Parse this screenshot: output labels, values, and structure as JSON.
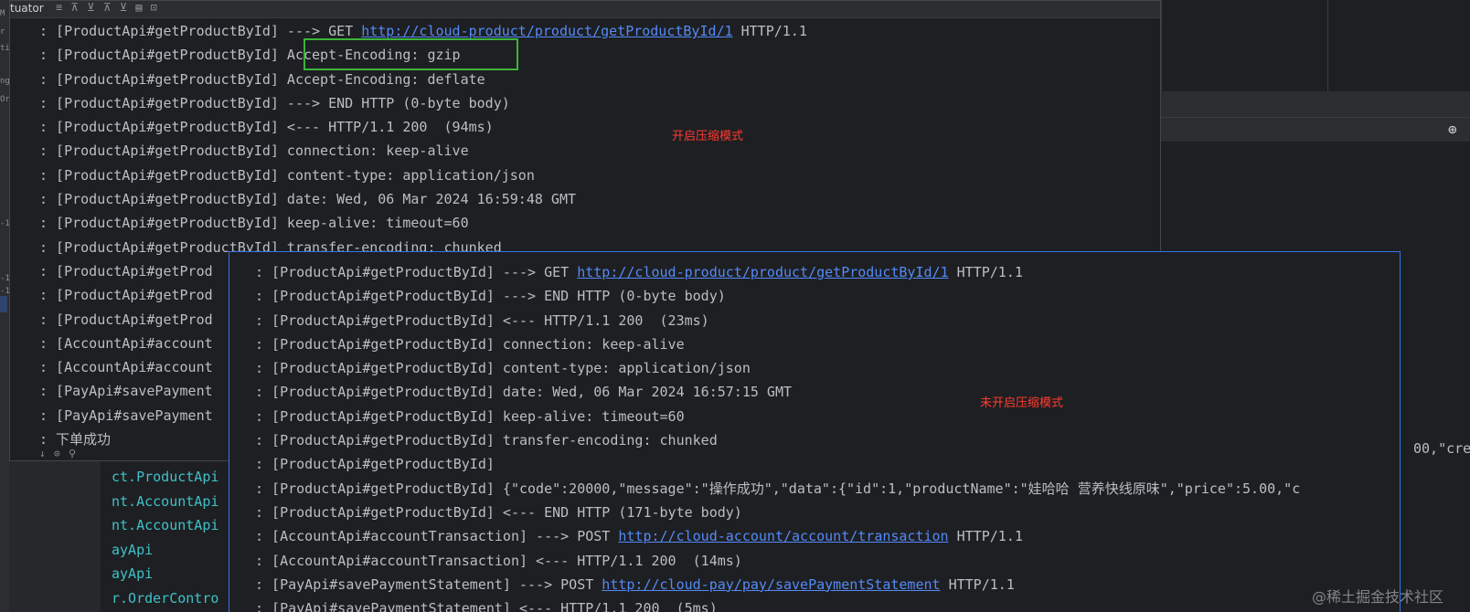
{
  "left_strip_marks": [
    "M",
    "r",
    "ti",
    "ng",
    "Or",
    "-1",
    "-1",
    "-1"
  ],
  "window_a": {
    "title": "tuator",
    "toolbar_icons": [
      "≡",
      "⊼",
      "⊻",
      "⊼",
      "⊻",
      "▤",
      "⊡"
    ],
    "lines": [
      {
        "text": ": [ProductApi#getProductById] ---> GET ",
        "url": "http://cloud-product/product/getProductById/1",
        "suffix": " HTTP/1.1"
      },
      {
        "text": ": [ProductApi#getProductById] Accept-Encoding: gzip"
      },
      {
        "text": ": [ProductApi#getProductById] Accept-Encoding: deflate"
      },
      {
        "text": ": [ProductApi#getProductById] ---> END HTTP (0-byte body)"
      },
      {
        "text": ": [ProductApi#getProductById] <--- HTTP/1.1 200  (94ms)"
      },
      {
        "text": ": [ProductApi#getProductById] connection: keep-alive"
      },
      {
        "text": ": [ProductApi#getProductById] content-type: application/json"
      },
      {
        "text": ": [ProductApi#getProductById] date: Wed, 06 Mar 2024 16:59:48 GMT"
      },
      {
        "text": ": [ProductApi#getProductById] keep-alive: timeout=60"
      },
      {
        "text": ": [ProductApi#getProductById] transfer-encoding: chunked"
      },
      {
        "text": ": [ProductApi#getProd"
      },
      {
        "text": ": [ProductApi#getProd"
      },
      {
        "text": ": [ProductApi#getProd"
      },
      {
        "text": ": [AccountApi#account"
      },
      {
        "text": ": [AccountApi#account"
      },
      {
        "text": ": [PayApi#savePayment"
      },
      {
        "text": ": [PayApi#savePayment"
      },
      {
        "text": ": 下单成功"
      }
    ],
    "footer": [
      "↓",
      "⊙",
      "⚲"
    ]
  },
  "label_compression_on": "开启压缩模式",
  "background_lines": [
    "ct.ProductApi",
    "nt.AccountApi",
    "nt.AccountApi",
    "ayApi",
    "ayApi",
    "r.OrderContro"
  ],
  "background_right_text": "00,\"cre",
  "window_b": {
    "lines": [
      {
        "text": ": [ProductApi#getProductById] ---> GET ",
        "url": "http://cloud-product/product/getProductById/1",
        "suffix": " HTTP/1.1"
      },
      {
        "text": ": [ProductApi#getProductById] ---> END HTTP (0-byte body)"
      },
      {
        "text": ": [ProductApi#getProductById] <--- HTTP/1.1 200  (23ms)"
      },
      {
        "text": ": [ProductApi#getProductById] connection: keep-alive"
      },
      {
        "text": ": [ProductApi#getProductById] content-type: application/json"
      },
      {
        "text": ": [ProductApi#getProductById] date: Wed, 06 Mar 2024 16:57:15 GMT"
      },
      {
        "text": ": [ProductApi#getProductById] keep-alive: timeout=60"
      },
      {
        "text": ": [ProductApi#getProductById] transfer-encoding: chunked"
      },
      {
        "text": ": [ProductApi#getProductById]"
      },
      {
        "text": ": [ProductApi#getProductById] {\"code\":20000,\"message\":\"操作成功\",\"data\":{\"id\":1,\"productName\":\"娃哈哈 营养快线原味\",\"price\":5.00,\"c"
      },
      {
        "text": ": [ProductApi#getProductById] <--- END HTTP (171-byte body)"
      },
      {
        "text": ": [AccountApi#accountTransaction] ---> POST ",
        "url": "http://cloud-account/account/transaction",
        "suffix": " HTTP/1.1"
      },
      {
        "text": ": [AccountApi#accountTransaction] <--- HTTP/1.1 200  (14ms)"
      },
      {
        "text": ": [PayApi#savePaymentStatement] ---> POST ",
        "url": "http://cloud-pay/pay/savePaymentStatement",
        "suffix": " HTTP/1.1"
      },
      {
        "text": ": [PayApi#savePaymentStatement] <--- HTTP/1.1 200  (5ms)"
      }
    ]
  },
  "label_compression_off": "未开启压缩模式",
  "watermark": "@稀土掘金技术社区",
  "colors": {
    "url": "#548af7",
    "annotation": "#ff3b30",
    "highlight_box": "#3cb43c",
    "selection_border": "#3574f0"
  }
}
